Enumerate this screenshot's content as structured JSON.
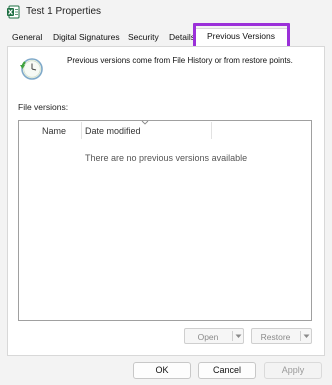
{
  "window": {
    "title": "Test 1 Properties",
    "app_icon": "excel-file-icon"
  },
  "tabs": [
    {
      "label": "General",
      "active": false
    },
    {
      "label": "Digital Signatures",
      "active": false
    },
    {
      "label": "Security",
      "active": false
    },
    {
      "label": "Details",
      "active": false
    },
    {
      "label": "Previous Versions",
      "active": true
    }
  ],
  "highlight_color": "#9b30d9",
  "previous_versions": {
    "icon": "file-history-clock-icon",
    "description": "Previous versions come from File History or from restore points.",
    "file_versions_label": "File versions:",
    "columns": [
      "Name",
      "Date modified"
    ],
    "empty_message": "There are no previous versions available",
    "open_label": "Open",
    "restore_label": "Restore"
  },
  "footer": {
    "ok_label": "OK",
    "cancel_label": "Cancel",
    "apply_label": "Apply"
  }
}
